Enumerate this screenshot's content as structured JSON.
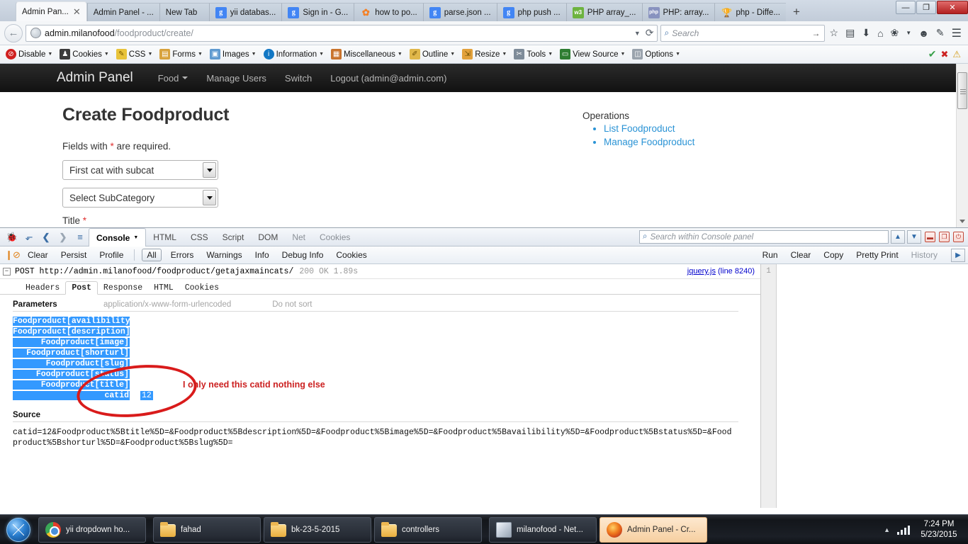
{
  "browser": {
    "tabs": [
      {
        "title": "Admin Pan...",
        "favicon": "none",
        "active": true,
        "closable": true
      },
      {
        "title": "Admin Panel - ...",
        "favicon": "none",
        "active": false
      },
      {
        "title": "New Tab",
        "favicon": "none",
        "active": false
      },
      {
        "title": "yii databas...",
        "favicon": "google-icon",
        "active": false
      },
      {
        "title": "Sign in - G...",
        "favicon": "google-icon",
        "active": false
      },
      {
        "title": "how to po...",
        "favicon": "stackoverflow-icon",
        "active": false
      },
      {
        "title": "parse.json ...",
        "favicon": "google-icon",
        "active": false
      },
      {
        "title": "php push ...",
        "favicon": "google-icon",
        "active": false
      },
      {
        "title": "PHP array_...",
        "favicon": "w3schools-icon",
        "active": false
      },
      {
        "title": "PHP: array...",
        "favicon": "php-icon",
        "active": false
      },
      {
        "title": "php - Diffe...",
        "favicon": "stackoverflow-icon",
        "active": false
      }
    ],
    "new_tab_label": "+",
    "window_controls": {
      "minimize": "—",
      "restore": "❐",
      "close": "✕"
    },
    "url": {
      "host": "admin.milanofood",
      "path": "/foodproduct/create/"
    },
    "search": {
      "placeholder": "Search"
    },
    "nav_icons": [
      "back-arrow-icon",
      "globe-icon",
      "dropdown-icon",
      "reload-icon",
      "search-icon",
      "go-arrow-icon",
      "bookmark-star-icon",
      "reader-icon",
      "downloads-icon",
      "home-icon",
      "pocket-icon",
      "smiley-icon",
      "highlighter-icon",
      "hamburger-menu-icon"
    ]
  },
  "webdev_toolbar": {
    "items": [
      {
        "label": "Disable",
        "icon": "disable-icon"
      },
      {
        "label": "Cookies",
        "icon": "cookies-icon"
      },
      {
        "label": "CSS",
        "icon": "css-icon"
      },
      {
        "label": "Forms",
        "icon": "forms-icon"
      },
      {
        "label": "Images",
        "icon": "images-icon"
      },
      {
        "label": "Information",
        "icon": "information-icon"
      },
      {
        "label": "Miscellaneous",
        "icon": "miscellaneous-icon"
      },
      {
        "label": "Outline",
        "icon": "outline-icon"
      },
      {
        "label": "Resize",
        "icon": "resize-icon"
      },
      {
        "label": "Tools",
        "icon": "tools-icon"
      },
      {
        "label": "View Source",
        "icon": "view-source-icon"
      },
      {
        "label": "Options",
        "icon": "options-icon"
      }
    ],
    "status_icons": [
      "green-check-icon",
      "red-error-icon",
      "yellow-warning-icon"
    ]
  },
  "site": {
    "brand": "Admin Panel",
    "nav": [
      {
        "label": "Food",
        "has_caret": true
      },
      {
        "label": "Manage Users",
        "has_caret": false
      },
      {
        "label": "Switch",
        "has_caret": false
      },
      {
        "label": "Logout (admin@admin.com)",
        "has_caret": false
      }
    ],
    "page_title": "Create Foodproduct",
    "required_note_before": "Fields with ",
    "required_star": "*",
    "required_note_after": " are required.",
    "category_select": "First cat with subcat",
    "subcategory_select": "Select SubCategory",
    "title_label": "Title",
    "title_star": "*",
    "operations": {
      "heading": "Operations",
      "links": [
        "List Foodproduct",
        "Manage Foodproduct"
      ],
      "link_color": "#2a93d5"
    }
  },
  "firebug": {
    "toolbar": {
      "icons": [
        "firebug-icon",
        "inspect-icon",
        "back-icon",
        "forward-icon",
        "console-options-icon"
      ],
      "panels": [
        {
          "label": "Console",
          "active": true,
          "has_caret": true
        },
        {
          "label": "HTML",
          "active": false
        },
        {
          "label": "CSS",
          "active": false
        },
        {
          "label": "Script",
          "active": false
        },
        {
          "label": "DOM",
          "active": false
        },
        {
          "label": "Net",
          "active": false,
          "dim": true
        },
        {
          "label": "Cookies",
          "active": false,
          "dim": true
        }
      ],
      "search_placeholder": "Search within Console panel",
      "window_buttons": [
        "minimize-panel-icon",
        "detach-panel-icon",
        "close-panel-icon"
      ]
    },
    "subtoolbar": {
      "left": [
        {
          "label": "Clear"
        },
        {
          "label": "Persist"
        },
        {
          "label": "Profile"
        }
      ],
      "filters": [
        {
          "label": "All",
          "active": true
        },
        {
          "label": "Errors",
          "active": false
        },
        {
          "label": "Warnings",
          "active": false
        },
        {
          "label": "Info",
          "active": false
        },
        {
          "label": "Debug Info",
          "active": false
        },
        {
          "label": "Cookies",
          "active": false
        }
      ],
      "right": [
        {
          "label": "Run"
        },
        {
          "label": "Clear"
        },
        {
          "label": "Copy"
        },
        {
          "label": "Pretty Print"
        },
        {
          "label": "History",
          "dim": true
        }
      ],
      "breakpoint_icon": "break-on-error-icon",
      "expand_icon": "expand-right-icon"
    },
    "log_entry": {
      "method_and_url": "POST http://admin.milanofood/foodproduct/getajaxmaincats/",
      "status": "200 OK 1.89s",
      "source_file": "jquery.js",
      "source_line": "(line 8240)",
      "gutter_number": "1",
      "twisty": "−"
    },
    "net_tabs": [
      {
        "label": "Headers",
        "active": false
      },
      {
        "label": "Post",
        "active": true
      },
      {
        "label": "Response",
        "active": false
      },
      {
        "label": "HTML",
        "active": false
      },
      {
        "label": "Cookies",
        "active": false
      }
    ],
    "parameters": {
      "heading": "Parameters",
      "content_type": "application/x-www-form-urlencoded",
      "sort_note": "Do not sort",
      "rows": [
        {
          "name": "Foodproduct[availibility]",
          "value": ""
        },
        {
          "name": "Foodproduct[description]",
          "value": ""
        },
        {
          "name": "Foodproduct[image]",
          "value": ""
        },
        {
          "name": "Foodproduct[shorturl]",
          "value": ""
        },
        {
          "name": "Foodproduct[slug]",
          "value": ""
        },
        {
          "name": "Foodproduct[status]",
          "value": ""
        },
        {
          "name": "Foodproduct[title]",
          "value": ""
        },
        {
          "name": "catid",
          "value": "12"
        }
      ]
    },
    "annotation": {
      "text": "I only need this catid nothing else",
      "color": "#cc2121"
    },
    "source": {
      "heading": "Source",
      "body": "catid=12&Foodproduct%5Btitle%5D=&Foodproduct%5Bdescription%5D=&Foodproduct%5Bimage%5D=&Foodproduct%5Bavailibility%5D=&Foodproduct%5Bstatus%5D=&Foodproduct%5Bshorturl%5D=&Foodproduct%5Bslug%5D="
    }
  },
  "taskbar": {
    "start_label": "start-orb",
    "buttons": [
      {
        "label": "yii dropdown ho...",
        "icon": "chrome-icon",
        "active": false
      },
      {
        "label": "fahad",
        "icon": "folder-icon",
        "active": false,
        "group_start": true
      },
      {
        "label": "bk-23-5-2015",
        "icon": "folder-icon",
        "active": false
      },
      {
        "label": "controllers",
        "icon": "folder-icon",
        "active": false
      },
      {
        "label": "milanofood - Net...",
        "icon": "cube-icon",
        "active": false,
        "group_start": true
      },
      {
        "label": "Admin Panel - Cr...",
        "icon": "firefox-icon",
        "active": true
      }
    ],
    "tray": {
      "show_hidden": "▲",
      "network_icon": "network-bars-icon"
    },
    "clock_time": "7:24 PM",
    "clock_date": "5/23/2015"
  }
}
